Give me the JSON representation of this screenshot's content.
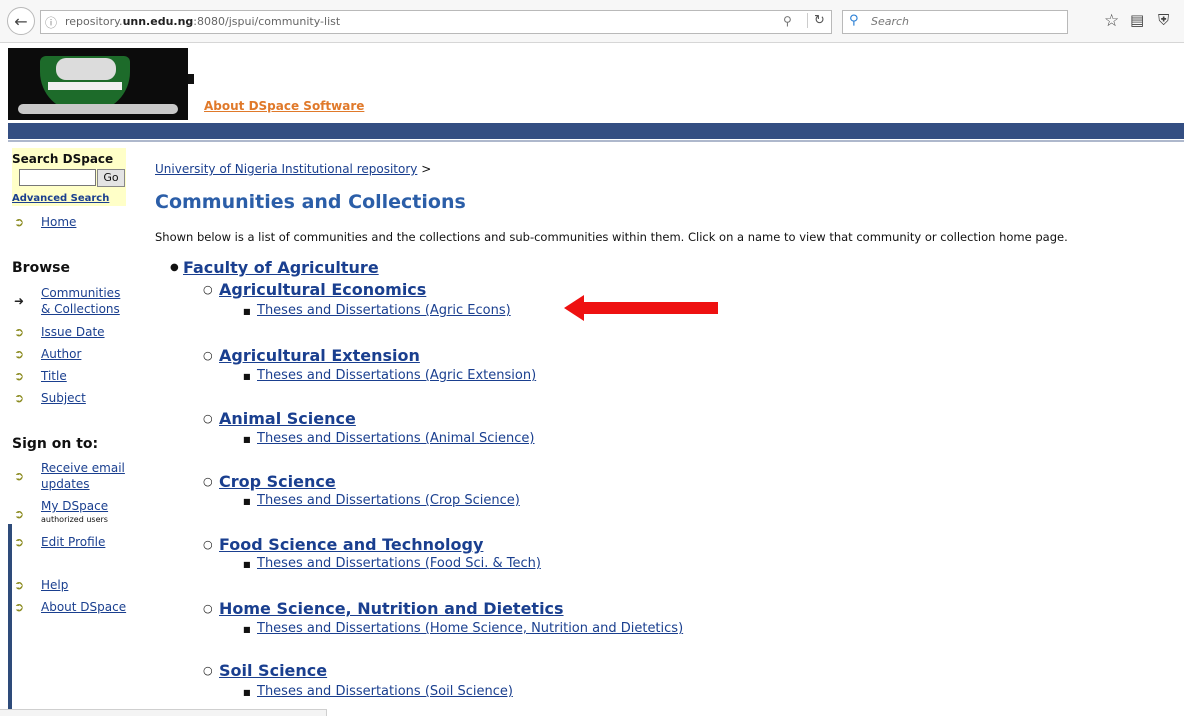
{
  "browser": {
    "url_plain_prefix": "repository.",
    "url_bold": "unn.edu.ng",
    "url_plain_suffix": ":8080/jspui/community-list",
    "search_placeholder": "Search"
  },
  "header": {
    "about_link": "About DSpace Software"
  },
  "sidebar": {
    "search_title": "Search DSpace",
    "go_button": "Go",
    "advanced_search": "Advanced Search",
    "home": "Home",
    "browse_heading": "Browse",
    "browse_communities_line1": "Communities",
    "browse_communities_line2": "& Collections",
    "browse_issue_date": "Issue Date",
    "browse_author": "Author",
    "browse_title": "Title",
    "browse_subject": "Subject",
    "signon_heading": "Sign on to:",
    "receive_email_line1": "Receive email",
    "receive_email_line2": "updates",
    "my_dspace": "My DSpace",
    "authorized_users": "authorized users",
    "edit_profile": "Edit Profile",
    "help": "Help",
    "about_dspace": "About DSpace"
  },
  "main": {
    "breadcrumb_link": "University of Nigeria Institutional repository",
    "breadcrumb_sep": ">",
    "title": "Communities and Collections",
    "intro": "Shown below is a list of communities and the collections and sub-communities within them. Click on a name to view that community or collection home page.",
    "community": "Faculty of Agriculture",
    "subcommunities": [
      {
        "name": "Agricultural Economics",
        "collection": "Theses and Dissertations (Agric Econs)"
      },
      {
        "name": "Agricultural Extension",
        "collection": "Theses and Dissertations (Agric Extension)"
      },
      {
        "name": "Animal Science",
        "collection": "Theses and Dissertations (Animal Science)"
      },
      {
        "name": "Crop Science",
        "collection": "Theses and Dissertations (Crop Science)"
      },
      {
        "name": "Food Science and Technology",
        "collection": "Theses and Dissertations (Food Sci. & Tech)"
      },
      {
        "name": "Home Science, Nutrition and Dietetics",
        "collection": "Theses and Dissertations (Home Science, Nutrition and Dietetics)"
      },
      {
        "name": "Soil Science",
        "collection": "Theses and Dissertations (Soil Science)"
      }
    ]
  },
  "annotation": {
    "arrow_color": "#ee1111"
  }
}
